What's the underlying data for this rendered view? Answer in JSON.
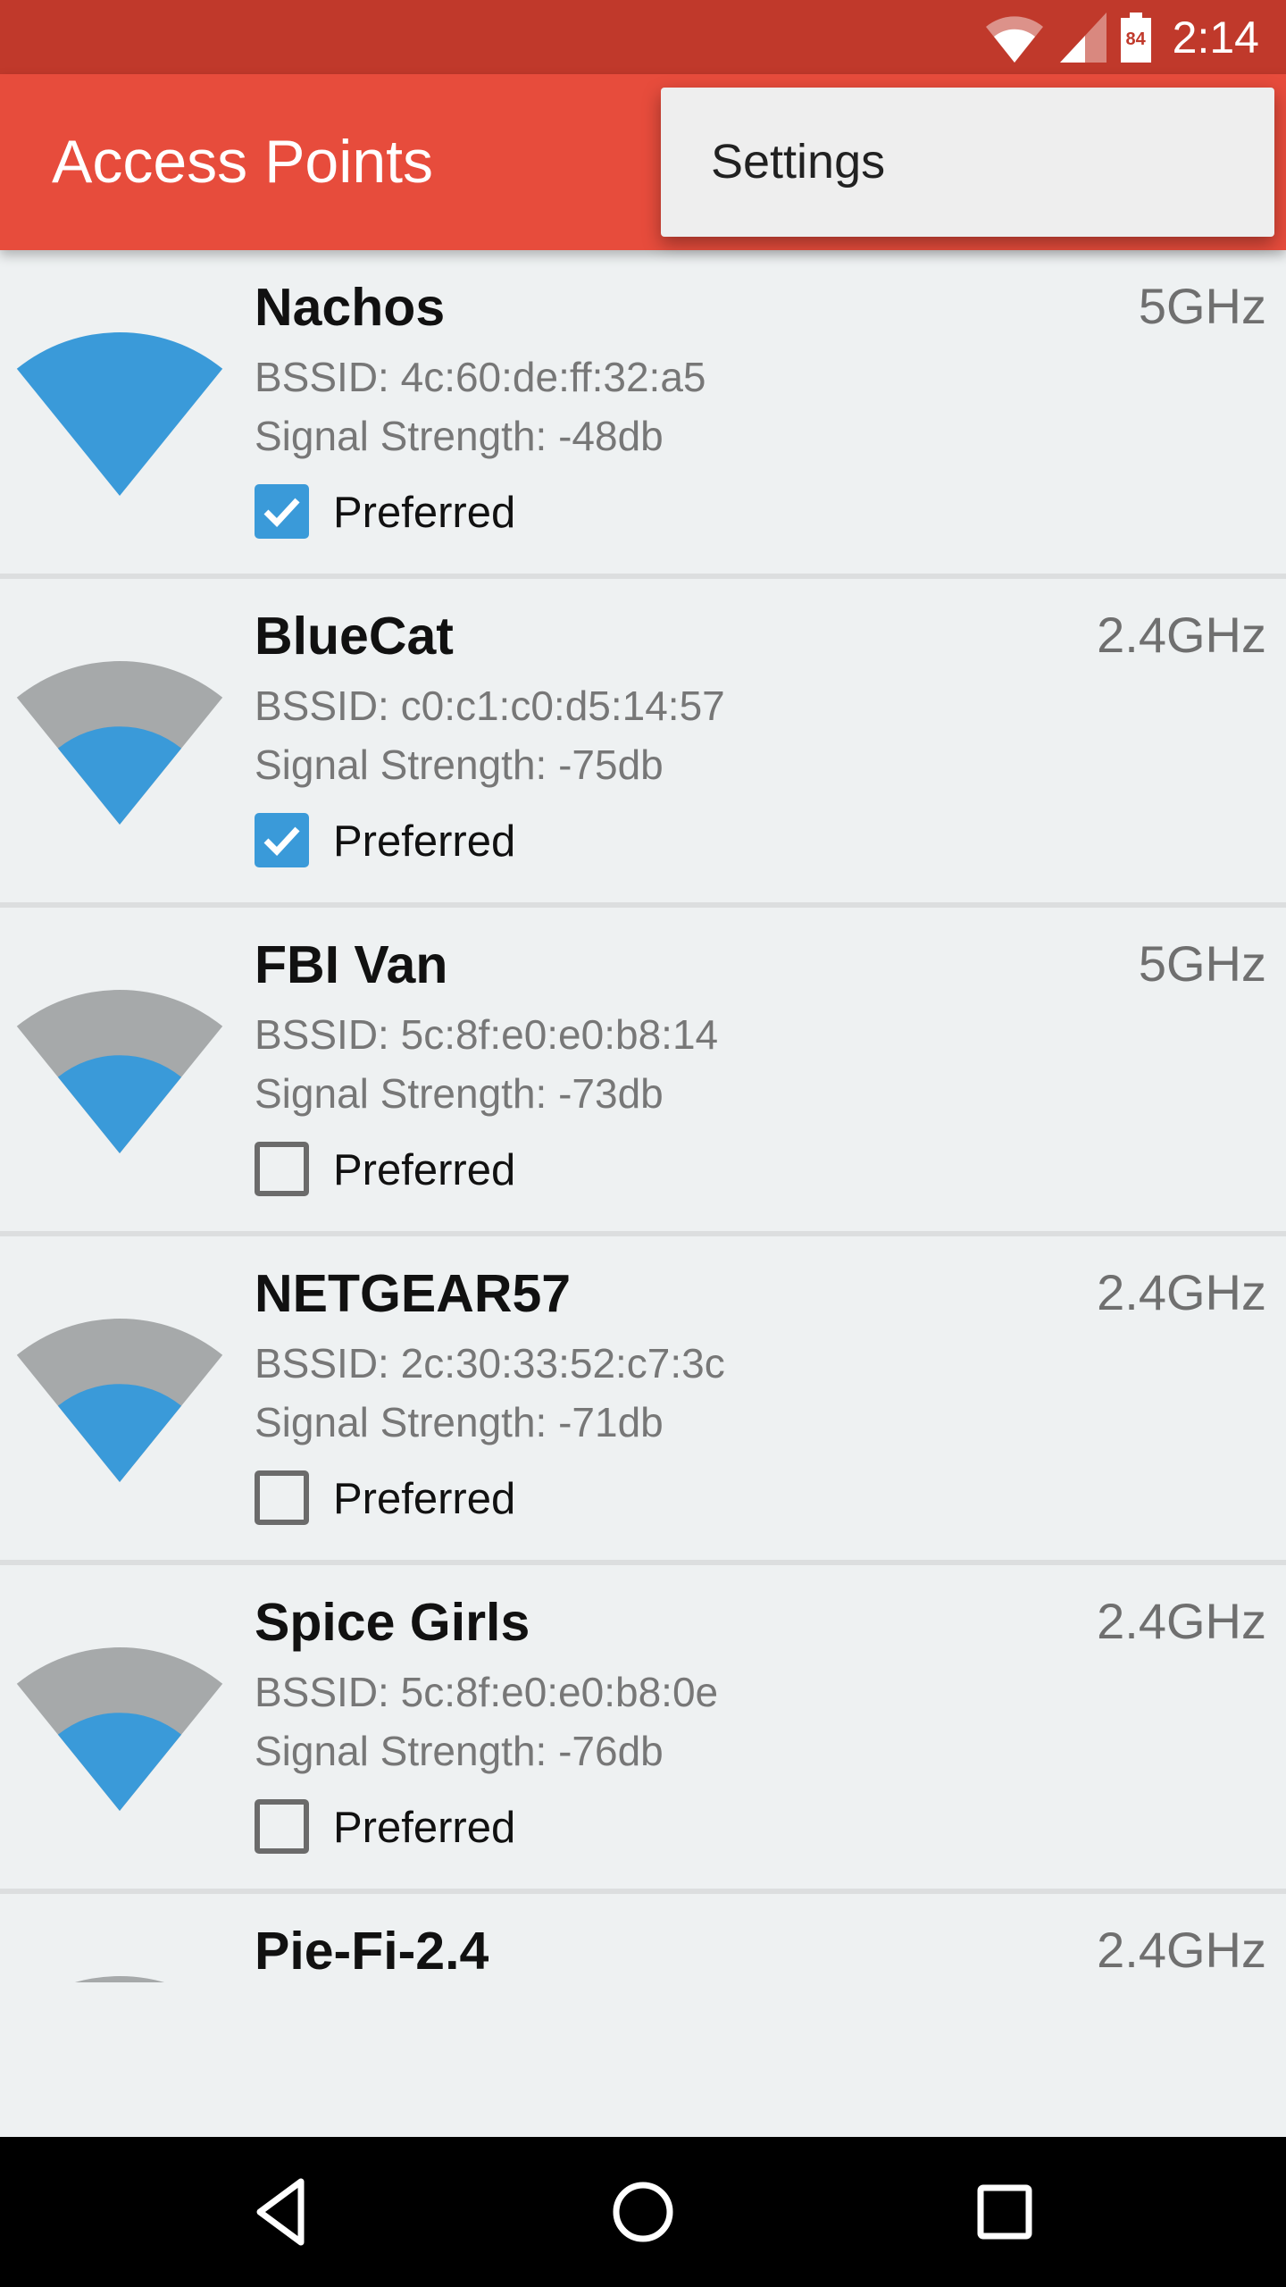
{
  "status_bar": {
    "time": "2:14",
    "battery_level": "84",
    "icons": [
      "wifi-icon",
      "cell-signal-icon",
      "battery-icon"
    ]
  },
  "toolbar": {
    "title": "Access Points"
  },
  "overflow_menu": {
    "items": [
      {
        "label": "Settings"
      }
    ]
  },
  "colors": {
    "status_bar": "#c0392b",
    "toolbar": "#e74c3c",
    "signal_fill": "#3a9ad9",
    "signal_empty": "#a6a9aa",
    "checkbox": "#3a9ad9"
  },
  "access_points": [
    {
      "name": "Nachos",
      "frequency": "5GHz",
      "bssid": "BSSID: 4c:60:de:ff:32:a5",
      "signal": "Signal Strength: -48db",
      "signal_fraction": 1.0,
      "preferred": true,
      "preferred_label": "Preferred"
    },
    {
      "name": "BlueCat",
      "frequency": "2.4GHz",
      "bssid": "BSSID: c0:c1:c0:d5:14:57",
      "signal": "Signal Strength: -75db",
      "signal_fraction": 0.6,
      "preferred": true,
      "preferred_label": "Preferred"
    },
    {
      "name": "FBI Van",
      "frequency": "5GHz",
      "bssid": "BSSID: 5c:8f:e0:e0:b8:14",
      "signal": "Signal Strength: -73db",
      "signal_fraction": 0.6,
      "preferred": false,
      "preferred_label": "Preferred"
    },
    {
      "name": "NETGEAR57",
      "frequency": "2.4GHz",
      "bssid": "BSSID: 2c:30:33:52:c7:3c",
      "signal": "Signal Strength: -71db",
      "signal_fraction": 0.6,
      "preferred": false,
      "preferred_label": "Preferred"
    },
    {
      "name": "Spice Girls",
      "frequency": "2.4GHz",
      "bssid": "BSSID: 5c:8f:e0:e0:b8:0e",
      "signal": "Signal Strength: -76db",
      "signal_fraction": 0.6,
      "preferred": false,
      "preferred_label": "Preferred"
    },
    {
      "name": "Pie-Fi-2.4",
      "frequency": "2.4GHz"
    }
  ],
  "nav_bar": {
    "buttons": [
      "back-icon",
      "home-icon",
      "recents-icon"
    ]
  }
}
